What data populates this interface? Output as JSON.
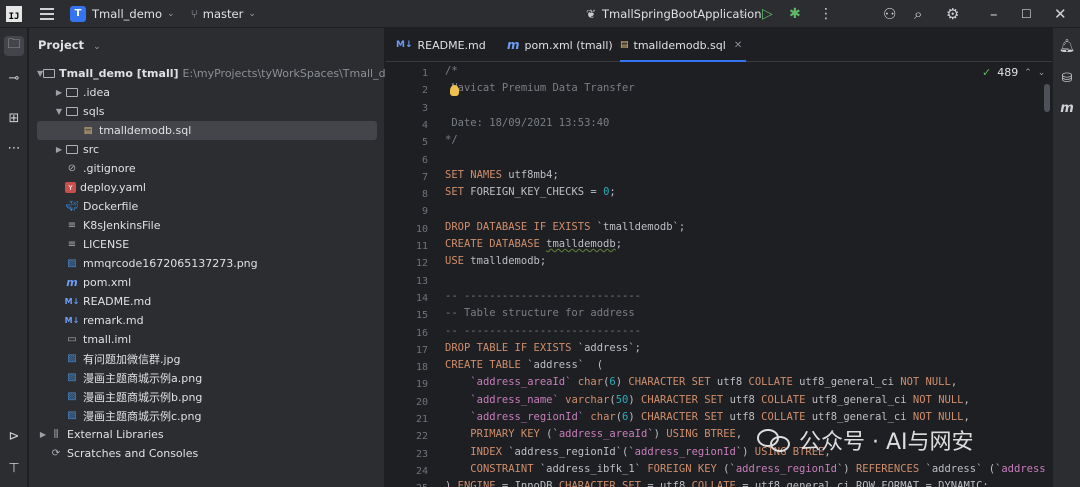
{
  "titlebar": {
    "ide_logo": "IJ",
    "project_badge": "T",
    "project_name": "Tmall_demo",
    "branch": "master",
    "run_config": "TmallSpringBootApplication"
  },
  "project_panel": {
    "title": "Project",
    "tree": [
      {
        "id": "root",
        "label": "Tmall_demo [tmall]",
        "path": "E:\\myProjects\\tyWorkSpaces\\Tmall_demo",
        "icon": "folder",
        "depth": 0,
        "expanded": true
      },
      {
        "id": "idea",
        "label": ".idea",
        "icon": "folder",
        "depth": 1,
        "expanded": false
      },
      {
        "id": "sqls",
        "label": "sqls",
        "icon": "folder",
        "depth": 1,
        "expanded": true
      },
      {
        "id": "sqlfile",
        "label": "tmalldemodb.sql",
        "icon": "sql-file",
        "depth": 2,
        "selected": true
      },
      {
        "id": "src",
        "label": "src",
        "icon": "folder",
        "depth": 1,
        "expanded": false
      },
      {
        "id": "gitignore",
        "label": ".gitignore",
        "icon": "gitignore",
        "depth": 1
      },
      {
        "id": "deploy",
        "label": "deploy.yaml",
        "icon": "yaml",
        "depth": 1
      },
      {
        "id": "dockerfile",
        "label": "Dockerfile",
        "icon": "docker",
        "depth": 1
      },
      {
        "id": "k8s",
        "label": "K8sJenkinsFile",
        "icon": "text-file",
        "depth": 1
      },
      {
        "id": "license",
        "label": "LICENSE",
        "icon": "text-file",
        "depth": 1
      },
      {
        "id": "mmqr",
        "label": "mmqrcode1672065137273.png",
        "icon": "image",
        "depth": 1
      },
      {
        "id": "pom",
        "label": "pom.xml",
        "icon": "maven",
        "depth": 1
      },
      {
        "id": "readme",
        "label": "README.md",
        "icon": "markdown",
        "depth": 1
      },
      {
        "id": "remark",
        "label": "remark.md",
        "icon": "markdown",
        "depth": 1
      },
      {
        "id": "iml",
        "label": "tmall.iml",
        "icon": "iml",
        "depth": 1
      },
      {
        "id": "wechat",
        "label": "有问题加微信群.jpg",
        "icon": "image",
        "depth": 1
      },
      {
        "id": "demoa",
        "label": "漫画主题商城示例a.png",
        "icon": "image",
        "depth": 1
      },
      {
        "id": "demob",
        "label": "漫画主题商城示例b.png",
        "icon": "image",
        "depth": 1
      },
      {
        "id": "democ",
        "label": "漫画主题商城示例c.png",
        "icon": "image",
        "depth": 1
      },
      {
        "id": "extlib",
        "label": "External Libraries",
        "icon": "library",
        "depth": 0,
        "expanded": false
      },
      {
        "id": "scratch",
        "label": "Scratches and Consoles",
        "icon": "scratch",
        "depth": 0
      }
    ]
  },
  "editor": {
    "tabs": [
      {
        "label": "README.md",
        "icon": "M↓",
        "active": false
      },
      {
        "label": "pom.xml (tmall)",
        "icon": "m",
        "active": false
      },
      {
        "label": "tmalldemodb.sql",
        "icon": "sql",
        "active": true
      }
    ],
    "inspection_count": "489",
    "lines": [
      {
        "n": "1",
        "t": [
          [
            "cm",
            "/*"
          ]
        ]
      },
      {
        "n": "2",
        "t": [
          [
            "cm",
            " Navicat Premium Data Transfer"
          ]
        ]
      },
      {
        "n": "3",
        "t": []
      },
      {
        "n": "4",
        "t": [
          [
            "cm",
            " Date: 18/09/2021 13:53:40"
          ]
        ]
      },
      {
        "n": "5",
        "t": [
          [
            "cm",
            "*/"
          ]
        ]
      },
      {
        "n": "6",
        "t": []
      },
      {
        "n": "7",
        "t": [
          [
            "kw",
            "SET NAMES "
          ],
          [
            "pl",
            "utf8mb4;"
          ]
        ]
      },
      {
        "n": "8",
        "t": [
          [
            "kw",
            "SET "
          ],
          [
            "pl",
            "FOREIGN_KEY_CHECKS = "
          ],
          [
            "nm",
            "0"
          ],
          [
            "pl",
            ";"
          ]
        ]
      },
      {
        "n": "9",
        "t": []
      },
      {
        "n": "10",
        "t": [
          [
            "kw",
            "DROP DATABASE IF EXISTS "
          ],
          [
            "pl",
            "`tmalldemodb`;"
          ]
        ]
      },
      {
        "n": "11",
        "t": [
          [
            "kw",
            "CREATE DATABASE "
          ],
          [
            "ul",
            "tmalldemodb"
          ],
          [
            "pl",
            ";"
          ]
        ]
      },
      {
        "n": "12",
        "t": [
          [
            "kw",
            "USE "
          ],
          [
            "pl",
            "tmalldemodb;"
          ]
        ]
      },
      {
        "n": "13",
        "t": []
      },
      {
        "n": "14",
        "t": [
          [
            "cm",
            "-- ----------------------------"
          ]
        ]
      },
      {
        "n": "15",
        "t": [
          [
            "cm",
            "-- Table structure for address"
          ]
        ]
      },
      {
        "n": "16",
        "t": [
          [
            "cm",
            "-- ----------------------------"
          ]
        ]
      },
      {
        "n": "17",
        "t": [
          [
            "kw",
            "DROP TABLE IF EXISTS "
          ],
          [
            "pl",
            "`address`;"
          ]
        ]
      },
      {
        "n": "18",
        "t": [
          [
            "kw",
            "CREATE TABLE "
          ],
          [
            "pl",
            "`address`  ("
          ]
        ]
      },
      {
        "n": "19",
        "t": [
          [
            "pl",
            "    "
          ],
          [
            "col",
            "`address_areaId`"
          ],
          [
            "pl",
            " "
          ],
          [
            "kw",
            "char"
          ],
          [
            "pl",
            "("
          ],
          [
            "nm",
            "6"
          ],
          [
            "pl",
            ") "
          ],
          [
            "kw",
            "CHARACTER SET "
          ],
          [
            "pl",
            "utf8 "
          ],
          [
            "kw",
            "COLLATE "
          ],
          [
            "pl",
            "utf8_general_ci "
          ],
          [
            "kw",
            "NOT NULL"
          ],
          [
            "pl",
            ","
          ]
        ]
      },
      {
        "n": "20",
        "t": [
          [
            "pl",
            "    "
          ],
          [
            "col",
            "`address_name`"
          ],
          [
            "pl",
            " "
          ],
          [
            "kw",
            "varchar"
          ],
          [
            "pl",
            "("
          ],
          [
            "nm",
            "50"
          ],
          [
            "pl",
            ") "
          ],
          [
            "kw",
            "CHARACTER SET "
          ],
          [
            "pl",
            "utf8 "
          ],
          [
            "kw",
            "COLLATE "
          ],
          [
            "pl",
            "utf8_general_ci "
          ],
          [
            "kw",
            "NOT NULL"
          ],
          [
            "pl",
            ","
          ]
        ]
      },
      {
        "n": "21",
        "t": [
          [
            "pl",
            "    "
          ],
          [
            "col",
            "`address_regionId`"
          ],
          [
            "pl",
            " "
          ],
          [
            "kw",
            "char"
          ],
          [
            "pl",
            "("
          ],
          [
            "nm",
            "6"
          ],
          [
            "pl",
            ") "
          ],
          [
            "kw",
            "CHARACTER SET "
          ],
          [
            "pl",
            "utf8 "
          ],
          [
            "kw",
            "COLLATE "
          ],
          [
            "pl",
            "utf8_general_ci "
          ],
          [
            "kw",
            "NOT NULL"
          ],
          [
            "pl",
            ","
          ]
        ]
      },
      {
        "n": "22",
        "t": [
          [
            "pl",
            "    "
          ],
          [
            "kw",
            "PRIMARY KEY "
          ],
          [
            "pl",
            "(`"
          ],
          [
            "col",
            "address_areaId"
          ],
          [
            "pl",
            "`) "
          ],
          [
            "kw",
            "USING BTREE"
          ],
          [
            "pl",
            ","
          ]
        ]
      },
      {
        "n": "23",
        "t": [
          [
            "pl",
            "    "
          ],
          [
            "kw",
            "INDEX "
          ],
          [
            "pl",
            "`address_regionId`(`"
          ],
          [
            "col",
            "address_regionId"
          ],
          [
            "pl",
            "`) "
          ],
          [
            "kw",
            "USING BTREE"
          ],
          [
            "pl",
            ","
          ]
        ]
      },
      {
        "n": "24",
        "t": [
          [
            "pl",
            "    "
          ],
          [
            "kw",
            "CONSTRAINT "
          ],
          [
            "pl",
            "`address_ibfk_1` "
          ],
          [
            "kw",
            "FOREIGN KEY "
          ],
          [
            "pl",
            "(`"
          ],
          [
            "col",
            "address_regionId"
          ],
          [
            "pl",
            "`) "
          ],
          [
            "kw",
            "REFERENCES "
          ],
          [
            "pl",
            "`address` (`"
          ],
          [
            "col",
            "address_a"
          ]
        ]
      },
      {
        "n": "25",
        "t": [
          [
            "pl",
            ") "
          ],
          [
            "kw",
            "ENGINE "
          ],
          [
            "pl",
            "= InnoDB "
          ],
          [
            "kw",
            "CHARACTER SET "
          ],
          [
            "pl",
            "= utf8 "
          ],
          [
            "kw",
            "COLLATE "
          ],
          [
            "pl",
            "= utf8_general_ci ROW_FORMAT = DYNAMIC;"
          ]
        ]
      }
    ]
  },
  "watermark": {
    "text": "公众号 · AI与网安"
  }
}
